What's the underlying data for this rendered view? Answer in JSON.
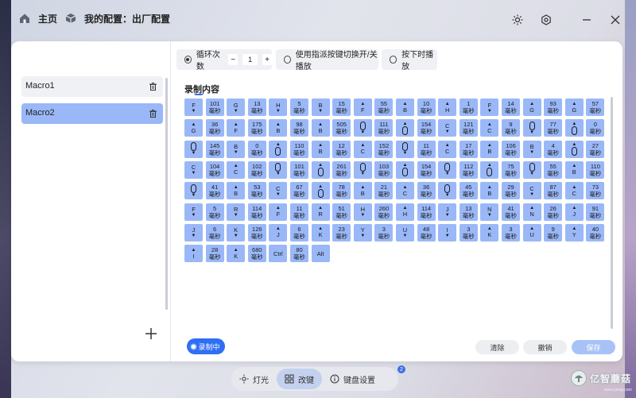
{
  "header": {
    "home": "主页",
    "config": "我的配置：出厂配置"
  },
  "macros": [
    {
      "name": "Macro1"
    },
    {
      "name": "Macro2",
      "selected": true
    }
  ],
  "options": {
    "loop_label": "循环次数",
    "loop_value": "1",
    "minus": "−",
    "plus": "+",
    "toggle_label": "使用指派按键切换开/关播放",
    "hold_label": "按下时播放"
  },
  "record": {
    "title": "录制内容"
  },
  "tiles": [
    [
      "F↓",
      "101",
      "G↓",
      "13",
      "H↓",
      "5",
      "B↓",
      "15",
      "F↑",
      "55",
      "B↑",
      "10",
      "H↑",
      "1",
      "F↓",
      "14",
      "G↑",
      "93",
      "G↑",
      "57"
    ],
    [
      "G↑",
      "36",
      "F↑",
      "175",
      "B↑",
      "98",
      "B↑",
      "505",
      "M↓",
      "111",
      "M↑",
      "154",
      "C↓",
      "121",
      "C↑",
      "9",
      "M↓",
      "77",
      "M↑",
      "0"
    ],
    [
      "M↓",
      "145",
      "B↓",
      "0",
      "M↑",
      "110",
      "B↑",
      "12",
      "C↑",
      "152",
      "M↓",
      "11",
      "C↑",
      "17",
      "B↑",
      "106",
      "B↓",
      "4",
      "M↑",
      "27"
    ],
    [
      "C↓",
      "104",
      "C↑",
      "102",
      "M↓",
      "101",
      "M↑",
      "261",
      "M↓",
      "103",
      "M↑",
      "154",
      "M↓",
      "112",
      "M↑",
      "75",
      "M↓",
      "55",
      "B↑",
      "110"
    ],
    [
      "M↓",
      "41",
      "B↑",
      "53",
      "C↓",
      "67",
      "M↑",
      "78",
      "B↑",
      "21",
      "C↑",
      "36",
      "M↓",
      "45",
      "B↑",
      "29",
      "C↓",
      "87",
      "C↑",
      "73"
    ],
    [
      "F↓",
      "5",
      "R↓",
      "114",
      "F↑",
      "11",
      "R↑",
      "51",
      "H↓",
      "260",
      "H↑",
      "114",
      "J↓",
      "13",
      "N↓",
      "41",
      "N↑",
      "26",
      "J↑",
      "91"
    ],
    [
      "J↓",
      "6",
      "K↓",
      "126",
      "J↑",
      "6",
      "K↑",
      "23",
      "Y↓",
      "3",
      "U↓",
      "48",
      "I↓",
      "3",
      "K↑",
      "3",
      "U↑",
      "9",
      "Y↑",
      "40"
    ],
    [
      "I↑",
      "28",
      "K↑",
      "680",
      "Ctrl",
      "80",
      "Alt"
    ]
  ],
  "unit": "毫秒",
  "actions": {
    "recording": "录制中",
    "clear": "清除",
    "cancel": "撤销",
    "save": "保存"
  },
  "bottom": {
    "light": "灯光",
    "keys": "改键",
    "settings": "键盘设置",
    "badge": "2"
  },
  "logo": {
    "name": "亿智蘑菇",
    "site": "www.yzmg.com"
  },
  "colors": {
    "accent": "#2f6ef5",
    "tile": "#9ab8f8",
    "selected": "#9ab8f8"
  }
}
